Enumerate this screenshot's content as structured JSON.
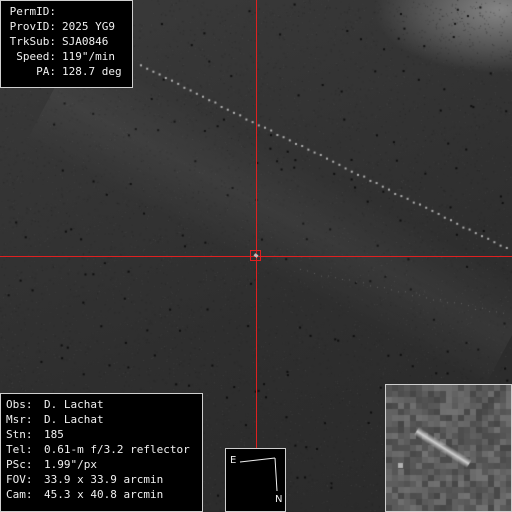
{
  "id_panel": {
    "rows": [
      {
        "key": "PermID:",
        "value": ""
      },
      {
        "key": "ProvID:",
        "value": "2025 YG9"
      },
      {
        "key": "TrkSub:",
        "value": "SJA0846"
      },
      {
        "key": "Speed:",
        "value": "119\"/min"
      },
      {
        "key": "PA:",
        "value": "128.7 deg"
      }
    ]
  },
  "obs_panel": {
    "rows": [
      {
        "key": "Obs:",
        "value": "D. Lachat"
      },
      {
        "key": "Msr:",
        "value": "D. Lachat"
      },
      {
        "key": "Stn:",
        "value": "185"
      },
      {
        "key": "Tel:",
        "value": "0.61-m f/3.2 reflector"
      },
      {
        "key": "PSc:",
        "value": "1.99\"/px"
      },
      {
        "key": "FOV:",
        "value": "33.9 x 33.9 arcmin"
      },
      {
        "key": "Cam:",
        "value": "45.3 x 40.8 arcmin"
      }
    ]
  },
  "compass": {
    "east_label": "E",
    "north_label": "N"
  },
  "colors": {
    "crosshair": "#e02020",
    "panel_bg": "#000000",
    "panel_text": "#f0f0f0"
  }
}
